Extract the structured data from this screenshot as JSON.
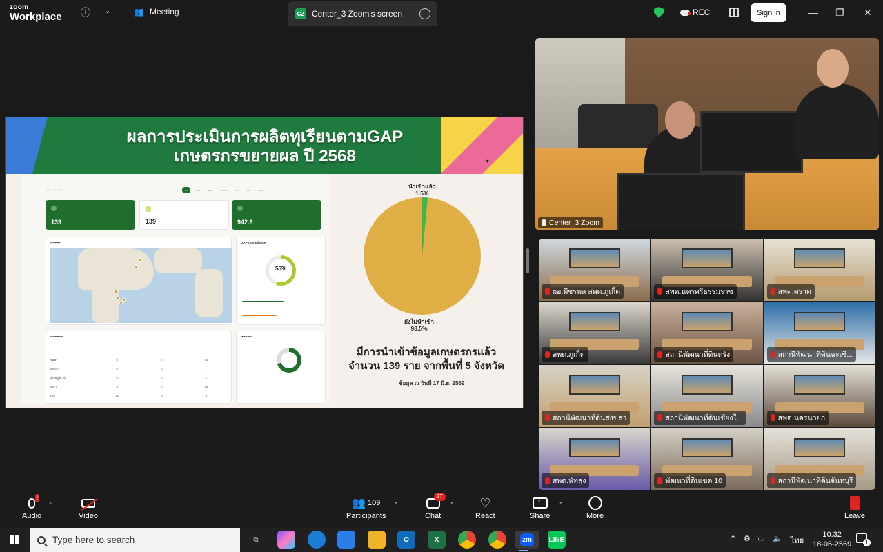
{
  "app": {
    "brand_top": "zoom",
    "brand_bottom": "Workplace"
  },
  "topbar": {
    "meeting_label": "Meeting",
    "share_tab": {
      "initials": "CZ",
      "label": "Center_3 Zoom's screen"
    },
    "rec_label": "REC",
    "signin_label": "Sign in"
  },
  "slide": {
    "title_line1": "ผลการประเมินการผลิตทุเรียนตามGAP",
    "title_line2": "เกษตรกรขยายผล ปี 2568",
    "kpis": [
      "139",
      "139",
      "942.6"
    ],
    "compliance_title": "GAP Compliance",
    "compliance_pct": "55%",
    "pie_label_small": "นำเข้าแล้ว\n1.5%",
    "pie_label_large": "ยังไม่นำเข้า\n98.5%",
    "caption_line1": "มีการนำเข้าข้อมูลเกษตรกรแล้ว",
    "caption_line2": "จำนวน 139 ราย จากพื้นที่ 5 จังหวัด",
    "note": "ข้อมูล ณ วันที่ 17 มิ.ย. 2569",
    "table_rows": [
      [
        "ชุมพร",
        "6",
        "0",
        "43"
      ],
      [
        "สงขลา",
        "0",
        "0",
        "1"
      ],
      [
        "สุราษฎร์ธานี",
        "0",
        "0",
        "2"
      ],
      [
        "พังงา",
        "8",
        "0",
        "14"
      ],
      [
        "ตรัง",
        "24",
        "0",
        "3"
      ]
    ]
  },
  "chart_data": {
    "type": "pie",
    "categories": [
      "นำเข้าแล้ว",
      "ยังไม่นำเข้า"
    ],
    "values": [
      1.5,
      98.5
    ],
    "colors": [
      "#3cb54a",
      "#dfae45"
    ]
  },
  "speaker": {
    "name": "Center_3 Zoom"
  },
  "gallery": [
    {
      "name": "ผอ.พีชรพล สพด.ภูเก็ต"
    },
    {
      "name": "สพด.นครศรีธรรมราช"
    },
    {
      "name": "สพด.ตราด"
    },
    {
      "name": "สพด.ภูเก็ต"
    },
    {
      "name": "สถานีพัฒนาที่ดินตรัง"
    },
    {
      "name": "สถานีพัฒนาที่ดินฉะเชิ..."
    },
    {
      "name": "สถานีพัฒนาที่ดินสงขลา"
    },
    {
      "name": "สถานีพัฒนาที่ดินเชียงใ..."
    },
    {
      "name": "สพด.นครนายก"
    },
    {
      "name": "สพด.พัทลุง"
    },
    {
      "name": "พัฒนาที่ดินเขต 10"
    },
    {
      "name": "สถานีพัฒนาที่ดินจันทบุรี"
    }
  ],
  "toolbar": {
    "audio": "Audio",
    "video": "Video",
    "participants": "Participants",
    "participants_count": "109",
    "chat": "Chat",
    "chat_badge": "27",
    "react": "React",
    "share": "Share",
    "more": "More",
    "leave": "Leave"
  },
  "taskbar": {
    "search_placeholder": "Type here to search",
    "lang": "ไทย",
    "time": "10:32",
    "date": "18-06-2569",
    "notif_count": "1"
  }
}
